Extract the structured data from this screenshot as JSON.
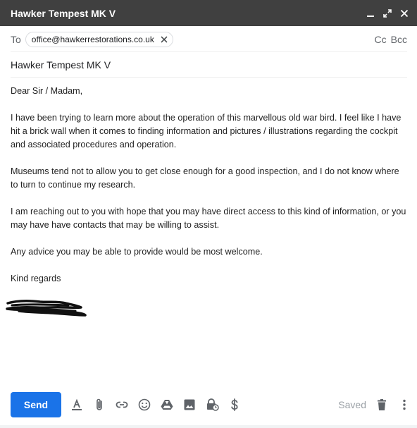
{
  "window": {
    "title": "Hawker Tempest MK V",
    "controls": [
      "minimize-icon",
      "expand-icon",
      "close-icon"
    ]
  },
  "recipients": {
    "to_label": "To",
    "chips": [
      "office@hawkerrestorations.co.uk"
    ],
    "cc_label": "Cc",
    "bcc_label": "Bcc"
  },
  "subject": "Hawker Tempest MK V",
  "body": {
    "greeting": "Dear Sir / Madam,",
    "paragraphs": [
      "I have been trying to learn more about the operation of this marvellous old war bird. I feel like I have hit a brick wall when it comes to finding information and pictures / illustrations regarding the cockpit and associated procedures and operation.",
      "Museums tend not to allow you to get close enough for a good inspection, and I do not know where to turn to continue my research.",
      "I am reaching out to you with hope that you may have direct access to this kind of information, or you may have have contacts that may be willing to assist.",
      "Any advice you may be able to provide would be most welcome."
    ],
    "closing": "Kind regards",
    "signature": "redacted-scribble"
  },
  "toolbar": {
    "send_label": "Send",
    "tools": [
      "format-text-icon",
      "attach-icon",
      "link-icon",
      "emoji-icon",
      "drive-icon",
      "photo-icon",
      "confidential-icon",
      "dollar-icon"
    ],
    "status": "Saved",
    "right_tools": [
      "trash-icon",
      "more-vert-icon"
    ]
  },
  "colors": {
    "header_bg": "#404040",
    "send_bg": "#1a73e8",
    "icon": "#5f6368",
    "status": "#9aa0a6"
  }
}
